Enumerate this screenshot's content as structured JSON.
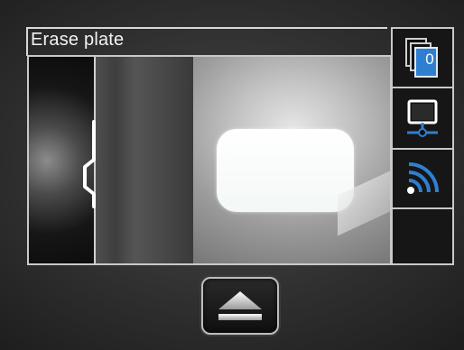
{
  "title": "Erase plate",
  "sidebar": {
    "plate_counter": "0"
  },
  "icons": {
    "plate_stack": "plate-stack-icon",
    "monitor": "monitor-network-icon",
    "wifi": "wireless-signal-icon",
    "eject": "eject-icon"
  },
  "colors": {
    "accent": "#2f7fd0",
    "frame": "#c9c9c9",
    "text": "#f2f2f2"
  }
}
